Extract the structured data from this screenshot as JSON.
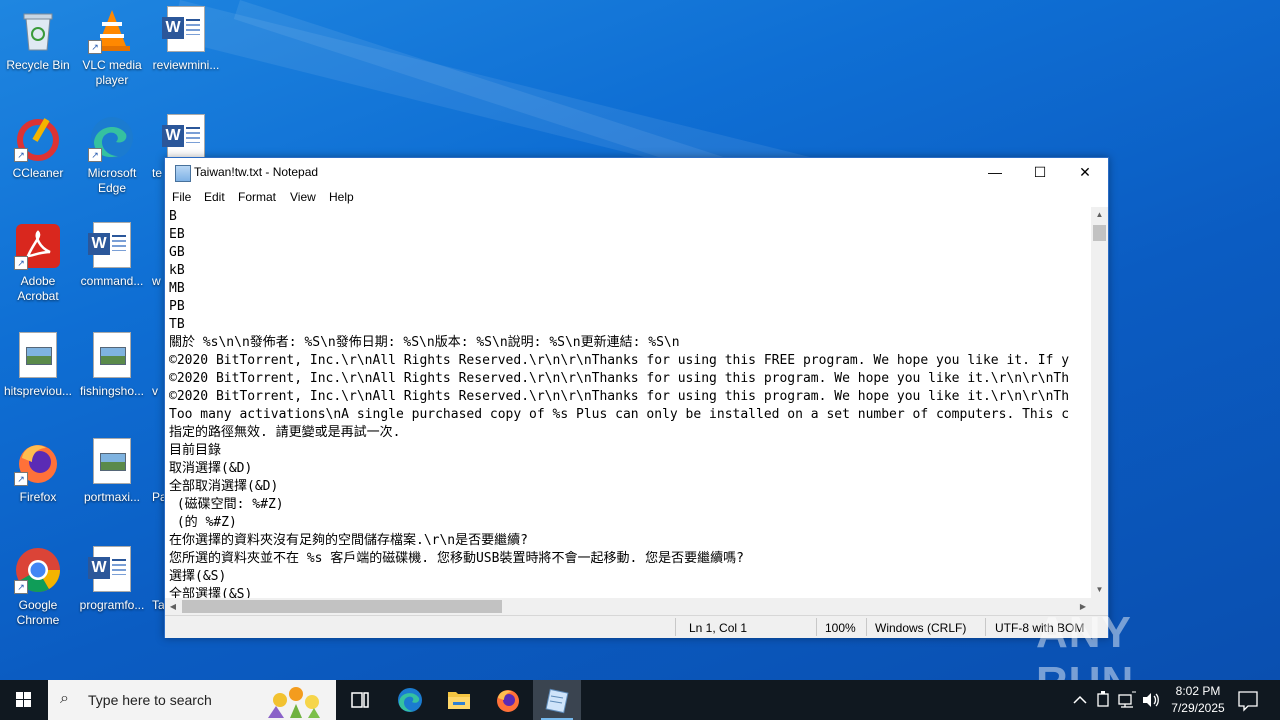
{
  "desktop": {
    "icons": [
      {
        "label": "Recycle Bin",
        "icon": "recycle-bin-icon"
      },
      {
        "label": "VLC media player",
        "icon": "vlc-icon"
      },
      {
        "label": "reviewmini...",
        "icon": "word-doc-icon"
      },
      {
        "label": "CCleaner",
        "icon": "ccleaner-icon"
      },
      {
        "label": "Microsoft Edge",
        "icon": "edge-icon"
      },
      {
        "label": "te",
        "icon": "word-doc-icon"
      },
      {
        "label": "Adobe Acrobat",
        "icon": "acrobat-icon"
      },
      {
        "label": "command...",
        "icon": "word-doc-icon"
      },
      {
        "label": "w",
        "icon": "word-doc-icon"
      },
      {
        "label": "hitspreviou...",
        "icon": "image-doc-icon"
      },
      {
        "label": "fishingsho...",
        "icon": "image-doc-icon"
      },
      {
        "label": "v",
        "icon": "image-doc-icon"
      },
      {
        "label": "Firefox",
        "icon": "firefox-icon"
      },
      {
        "label": "portmaxi...",
        "icon": "image-doc-icon"
      },
      {
        "label": "Pa",
        "icon": "image-doc-icon"
      },
      {
        "label": "Google Chrome",
        "icon": "chrome-icon"
      },
      {
        "label": "programfo...",
        "icon": "word-doc-icon"
      },
      {
        "label": "Ta",
        "icon": "word-doc-icon"
      }
    ]
  },
  "notepad": {
    "title": "Taiwan!tw.txt - Notepad",
    "window_buttons": {
      "minimize": "—",
      "maximize": "☐",
      "close": "✕"
    },
    "menu": [
      "File",
      "Edit",
      "Format",
      "View",
      "Help"
    ],
    "lines": [
      "B",
      "EB",
      "GB",
      "kB",
      "MB",
      "PB",
      "TB",
      "關於 %s\\n\\n發佈者: %S\\n發佈日期: %S\\n版本: %S\\n說明: %S\\n更新連結: %S\\n",
      "©2020 BitTorrent, Inc.\\r\\nAll Rights Reserved.\\r\\n\\r\\nThanks for using this FREE program. We hope you like it. If y",
      "©2020 BitTorrent, Inc.\\r\\nAll Rights Reserved.\\r\\n\\r\\nThanks for using this program. We hope you like it.\\r\\n\\r\\nTh",
      "©2020 BitTorrent, Inc.\\r\\nAll Rights Reserved.\\r\\n\\r\\nThanks for using this program. We hope you like it.\\r\\n\\r\\nTh",
      "Too many activations\\nA single purchased copy of %s Plus can only be installed on a set number of computers. This c",
      "指定的路徑無效. 請更變或是再試一次.",
      "目前目錄",
      "取消選擇(&D)",
      "全部取消選擇(&D)",
      " (磁碟空間: %#Z)",
      " (的 %#Z)",
      "在你選擇的資料夾沒有足夠的空間儲存檔案.\\r\\n是否要繼續?",
      "您所選的資料夾並不在 %s 客戶端的磁碟機. 您移動USB裝置時將不會一起移動. 您是否要繼續嗎?",
      "選擇(&S)",
      "全部選擇(&S)"
    ],
    "status": {
      "position": "Ln 1, Col 1",
      "zoom": "100%",
      "line_endings": "Windows (CRLF)",
      "encoding": "UTF-8 with BOM"
    }
  },
  "watermark": "ANY RUN",
  "taskbar": {
    "search_placeholder": "Type here to search",
    "pinned": [
      "task-view-icon",
      "edge-icon",
      "file-explorer-icon",
      "firefox-icon",
      "notepad-icon"
    ],
    "clock_time": "8:02 PM",
    "clock_date": "7/29/2025"
  }
}
